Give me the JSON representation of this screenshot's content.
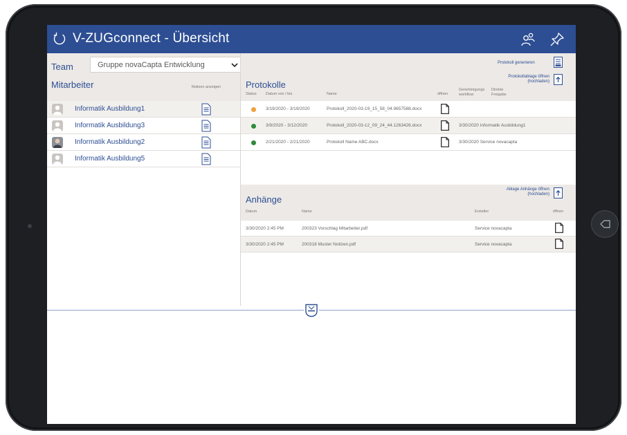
{
  "app": {
    "title": "V-ZUGconnect - Übersicht"
  },
  "team": {
    "label": "Team",
    "selected": "Gruppe novaCapta Entwicklung"
  },
  "employees": {
    "title": "Mitarbeiter",
    "notes_header": "Notizen anzeigen",
    "items": [
      {
        "name": "Informatik Ausbildung1",
        "selected": true,
        "avatar": "placeholder"
      },
      {
        "name": "Informatik Ausbildung3",
        "selected": false,
        "avatar": "placeholder"
      },
      {
        "name": "Informatik Ausbildung2",
        "selected": false,
        "avatar": "photo"
      },
      {
        "name": "Informatik Ausbildung5",
        "selected": false,
        "avatar": "placeholder"
      }
    ]
  },
  "protocols": {
    "title": "Protokolle",
    "generate_label": "Protokoll generieren",
    "storage_label": "Protokollablage öffnen (hochladen)",
    "columns": {
      "status": "Status",
      "date": "Datum von / bis",
      "name": "Name",
      "open": "öffnen",
      "workflow": "Genehmigungs workflow",
      "release": "Direkte Freigabe"
    },
    "rows": [
      {
        "status_color": "#f2a03d",
        "date": "3/19/2020 - 3/19/2020",
        "name": "Protokoll_2020-03-19_15_58_04.9657588.docx",
        "workflow": ""
      },
      {
        "status_color": "#2e8b3a",
        "date": "3/9/2020 - 3/12/2020",
        "name": "Protokoll_2020-03-12_09_24_44.1263426.docx",
        "workflow": "3/30/2020 Informatik Ausbildung1"
      },
      {
        "status_color": "#2e8b3a",
        "date": "2/21/2020 - 2/21/2020",
        "name": "Protokoll Name ABC.docx",
        "workflow": "3/30/2020 Service novacapta"
      }
    ]
  },
  "attachments": {
    "title": "Anhänge",
    "storage_label": "Ablage Anhänge öffnen (hochladen)",
    "columns": {
      "date": "Datum",
      "name": "Name",
      "creator": "Ersteller",
      "open": "öffnen"
    },
    "rows": [
      {
        "date": "3/30/2020 2:45 PM",
        "name": "200323 Vorschlag Mitarbeiter.pdf",
        "creator": "Service novacapta"
      },
      {
        "date": "3/30/2020 2:45 PM",
        "name": "200318 Muster Notizen.pdf",
        "creator": "Service novacapta"
      }
    ]
  },
  "colors": {
    "brand": "#2d4e93",
    "panel": "#ece9e6",
    "row_alt": "#f2f0ed"
  },
  "icons": {
    "refresh": "refresh-icon",
    "people": "people-icon",
    "pin": "pin-icon",
    "note": "note-icon",
    "file": "file-icon",
    "logo": "vzug-logo"
  }
}
